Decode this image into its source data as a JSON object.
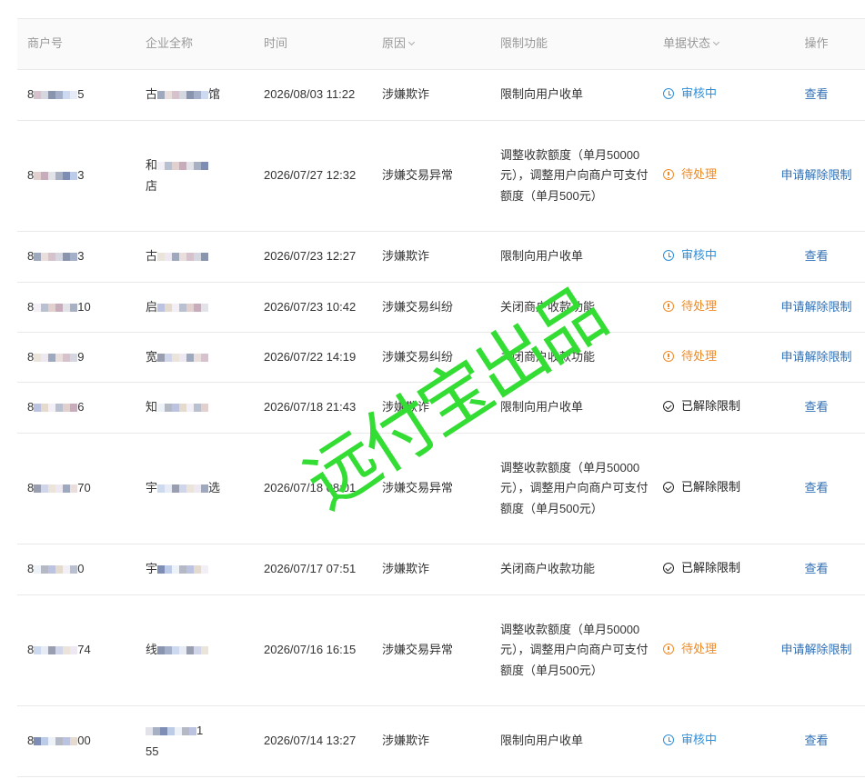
{
  "table": {
    "headers": {
      "merchant_id": "商户号",
      "company": "企业全称",
      "time": "时间",
      "reason": "原因",
      "restriction": "限制功能",
      "status": "单据状态",
      "action": "操作"
    },
    "rows": [
      {
        "merchant_prefix": "8",
        "merchant_suffix": "5",
        "company_prefix": "古",
        "company_suffix": "馆",
        "company_line2": "",
        "time": "2026/08/03 11:22",
        "reason": "涉嫌欺诈",
        "restriction": "限制向用户收单",
        "status": "审核中",
        "status_type": "review",
        "action": "查看",
        "height": 56
      },
      {
        "merchant_prefix": "8",
        "merchant_suffix": "3",
        "company_prefix": "和",
        "company_suffix": "",
        "company_line2": "店",
        "time": "2026/07/27 12:32",
        "reason": "涉嫌交易异常",
        "restriction": "调整收款额度（单月50000元），调整用户向商户可支付额度（单月500元）",
        "status": "待处理",
        "status_type": "pending",
        "action": "申请解除限制",
        "height": 122
      },
      {
        "merchant_prefix": "8",
        "merchant_suffix": "3",
        "company_prefix": "古",
        "company_suffix": "",
        "company_line2": "",
        "time": "2026/07/23 12:27",
        "reason": "涉嫌欺诈",
        "restriction": "限制向用户收单",
        "status": "审核中",
        "status_type": "review",
        "action": "查看",
        "height": 56
      },
      {
        "merchant_prefix": "8",
        "merchant_suffix": "10",
        "company_prefix": "启",
        "company_suffix": "",
        "company_line2": "",
        "time": "2026/07/23 10:42",
        "reason": "涉嫌交易纠纷",
        "restriction": "关闭商户收款功能",
        "status": "待处理",
        "status_type": "pending",
        "action": "申请解除限制",
        "height": 55
      },
      {
        "merchant_prefix": "8",
        "merchant_suffix": "9",
        "company_prefix": "宽",
        "company_suffix": "",
        "company_line2": "",
        "time": "2026/07/22 14:19",
        "reason": "涉嫌交易纠纷",
        "restriction": "关闭商户收款功能",
        "status": "待处理",
        "status_type": "pending",
        "action": "申请解除限制",
        "height": 55
      },
      {
        "merchant_prefix": "8",
        "merchant_suffix": "6",
        "company_prefix": "知",
        "company_suffix": "",
        "company_line2": "",
        "time": "2026/07/18 21:43",
        "reason": "涉嫌欺诈",
        "restriction": "限制向用户收单",
        "status": "已解除限制",
        "status_type": "lifted",
        "action": "查看",
        "height": 56
      },
      {
        "merchant_prefix": "8",
        "merchant_suffix": "70",
        "company_prefix": "宇",
        "company_suffix": "选",
        "company_line2": "",
        "time": "2026/07/18 08:01",
        "reason": "涉嫌交易异常",
        "restriction": "调整收款额度（单月50000元），调整用户向商户可支付额度（单月500元）",
        "status": "已解除限制",
        "status_type": "lifted",
        "action": "查看",
        "height": 122
      },
      {
        "merchant_prefix": "8",
        "merchant_suffix": "0",
        "company_prefix": "宇",
        "company_suffix": "",
        "company_line2": "",
        "time": "2026/07/17 07:51",
        "reason": "涉嫌欺诈",
        "restriction": "关闭商户收款功能",
        "status": "已解除限制",
        "status_type": "lifted",
        "action": "查看",
        "height": 56
      },
      {
        "merchant_prefix": "8",
        "merchant_suffix": "74",
        "company_prefix": "线",
        "company_suffix": "",
        "company_line2": "",
        "time": "2026/07/16 16:15",
        "reason": "涉嫌交易异常",
        "restriction": "调整收款额度（单月50000元），调整用户向商户可支付额度（单月500元）",
        "status": "待处理",
        "status_type": "pending",
        "action": "申请解除限制",
        "height": 122
      },
      {
        "merchant_prefix": "8",
        "merchant_suffix": "00",
        "company_prefix": "",
        "company_suffix": "1",
        "company_line2": "55",
        "time": "2026/07/14 13:27",
        "reason": "涉嫌欺诈",
        "restriction": "限制向用户收单",
        "status": "审核中",
        "status_type": "review",
        "action": "查看",
        "height": 78
      }
    ]
  },
  "colors": {
    "review": "#2f8fd8",
    "pending": "#f08a24",
    "lifted": "#222222",
    "link": "#2f6fb5",
    "watermark": "#33dd33"
  },
  "icons": {
    "review": "clock-icon",
    "pending": "alert-circle-icon",
    "lifted": "check-circle-icon",
    "sort": "chevron-down-icon"
  },
  "watermark": "远付宝出品"
}
